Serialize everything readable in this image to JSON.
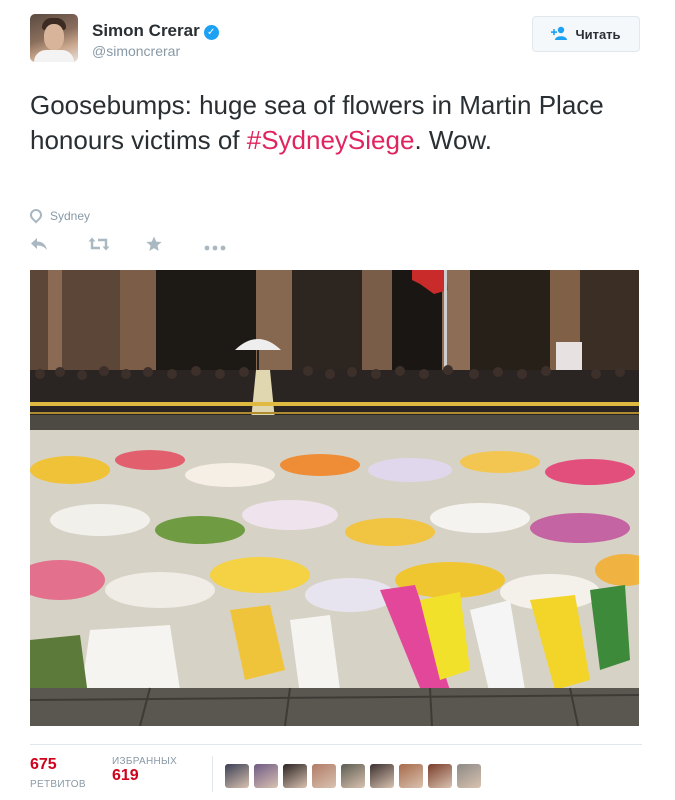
{
  "user": {
    "display_name": "Simon Crerar",
    "handle": "@simoncrerar",
    "verified_icon": "✓"
  },
  "follow_button": {
    "label": "Читать",
    "icon": "follow-plus-icon"
  },
  "tweet": {
    "text_before": "Goosebumps: huge sea of flowers in Martin Place honours victims of ",
    "hashtag": "#SydneySiege",
    "text_after": ". Wow.",
    "hashtag_color": "#e0245e"
  },
  "location": {
    "label": "Sydney"
  },
  "actions": {
    "reply": "reply-icon",
    "retweet": "retweet-icon",
    "favorite": "favorite-star-icon",
    "more": "more-dots-icon"
  },
  "stats": {
    "retweets_count": "675",
    "retweets_label": "РЕТВИТОВ",
    "favorites_label": "ИЗБРАННЫХ",
    "favorites_count": "619"
  },
  "favorited_by_avatars": [
    {
      "color": "#3a3f55"
    },
    {
      "color": "#6f5a86"
    },
    {
      "color": "#2c2424"
    },
    {
      "color": "#b07c67"
    },
    {
      "color": "#5b5d52"
    },
    {
      "color": "#3c3030"
    },
    {
      "color": "#a76a4a"
    },
    {
      "color": "#7a3d2b"
    },
    {
      "color": "#8d8a86"
    }
  ]
}
